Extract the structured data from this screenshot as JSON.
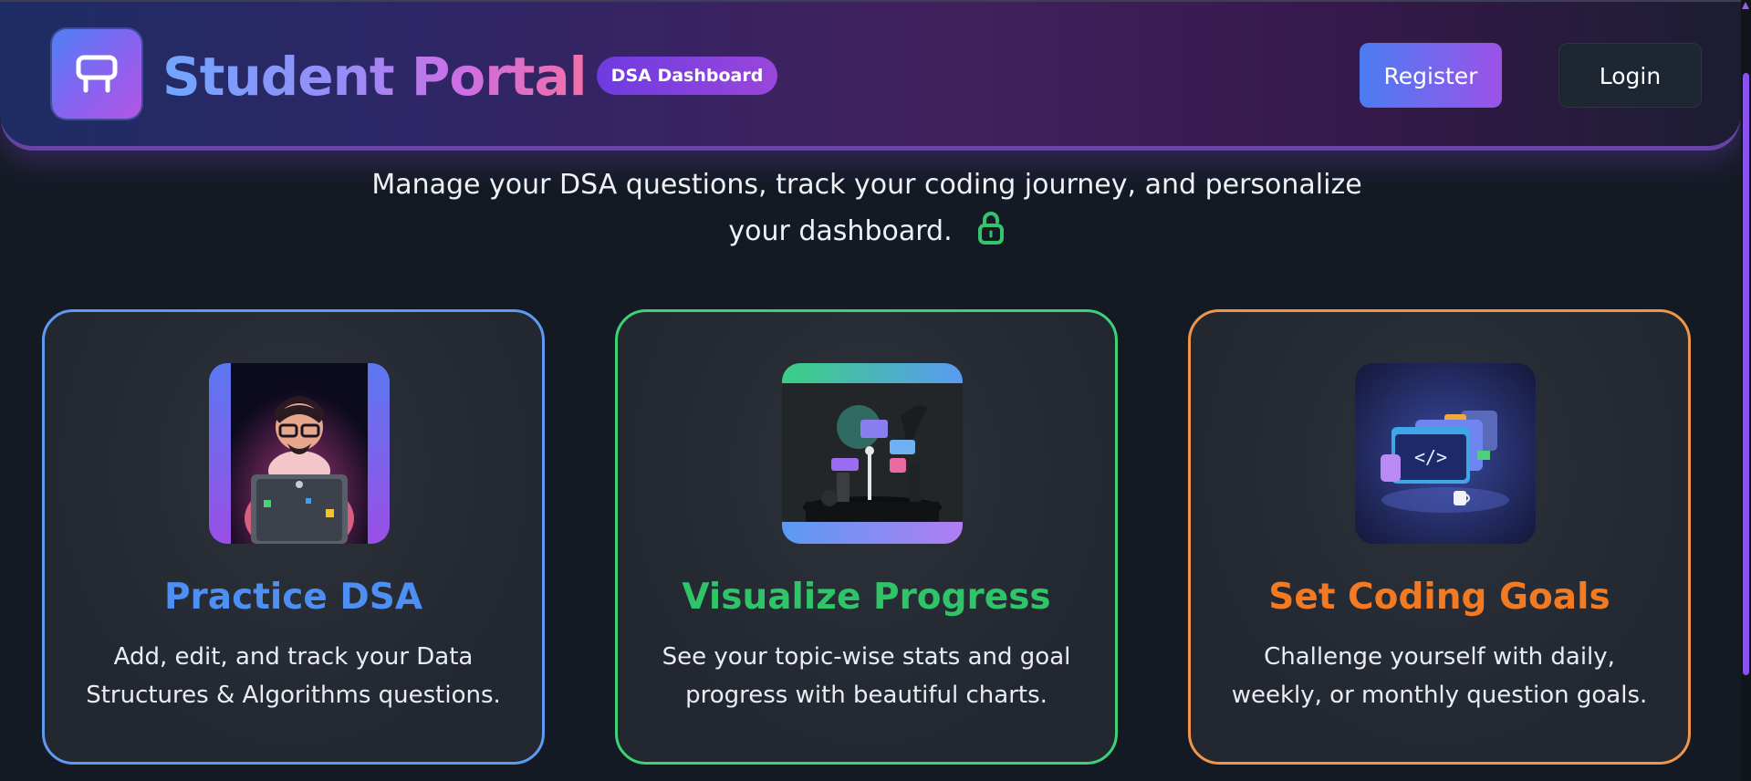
{
  "header": {
    "brand": "Student Portal",
    "badge": "DSA Dashboard",
    "register_label": "Register",
    "login_label": "Login"
  },
  "hero": {
    "tagline": "Manage your DSA questions, track your coding journey, and personalize your dashboard."
  },
  "features": [
    {
      "title": "Practice DSA",
      "description": "Add, edit, and track your Data Structures & Algorithms questions.",
      "accent": "#5d9bf2",
      "title_color": "#4d8ff3",
      "illustration": "coder-with-laptop-illustration"
    },
    {
      "title": "Visualize Progress",
      "description": "See your topic-wise stats and goal progress with beautiful charts.",
      "accent": "#3cd276",
      "title_color": "#2fc468",
      "illustration": "charts-dashboard-illustration"
    },
    {
      "title": "Set Coding Goals",
      "description": "Challenge yourself with daily, weekly, or monthly question goals.",
      "accent": "#f0954a",
      "title_color": "#f27a22",
      "illustration": "code-windows-illustration"
    }
  ],
  "colors": {
    "background": "#141a23",
    "header_gradient_start": "#1d2c63",
    "header_gradient_end": "#42205e",
    "lock_icon": "#34c46e"
  }
}
